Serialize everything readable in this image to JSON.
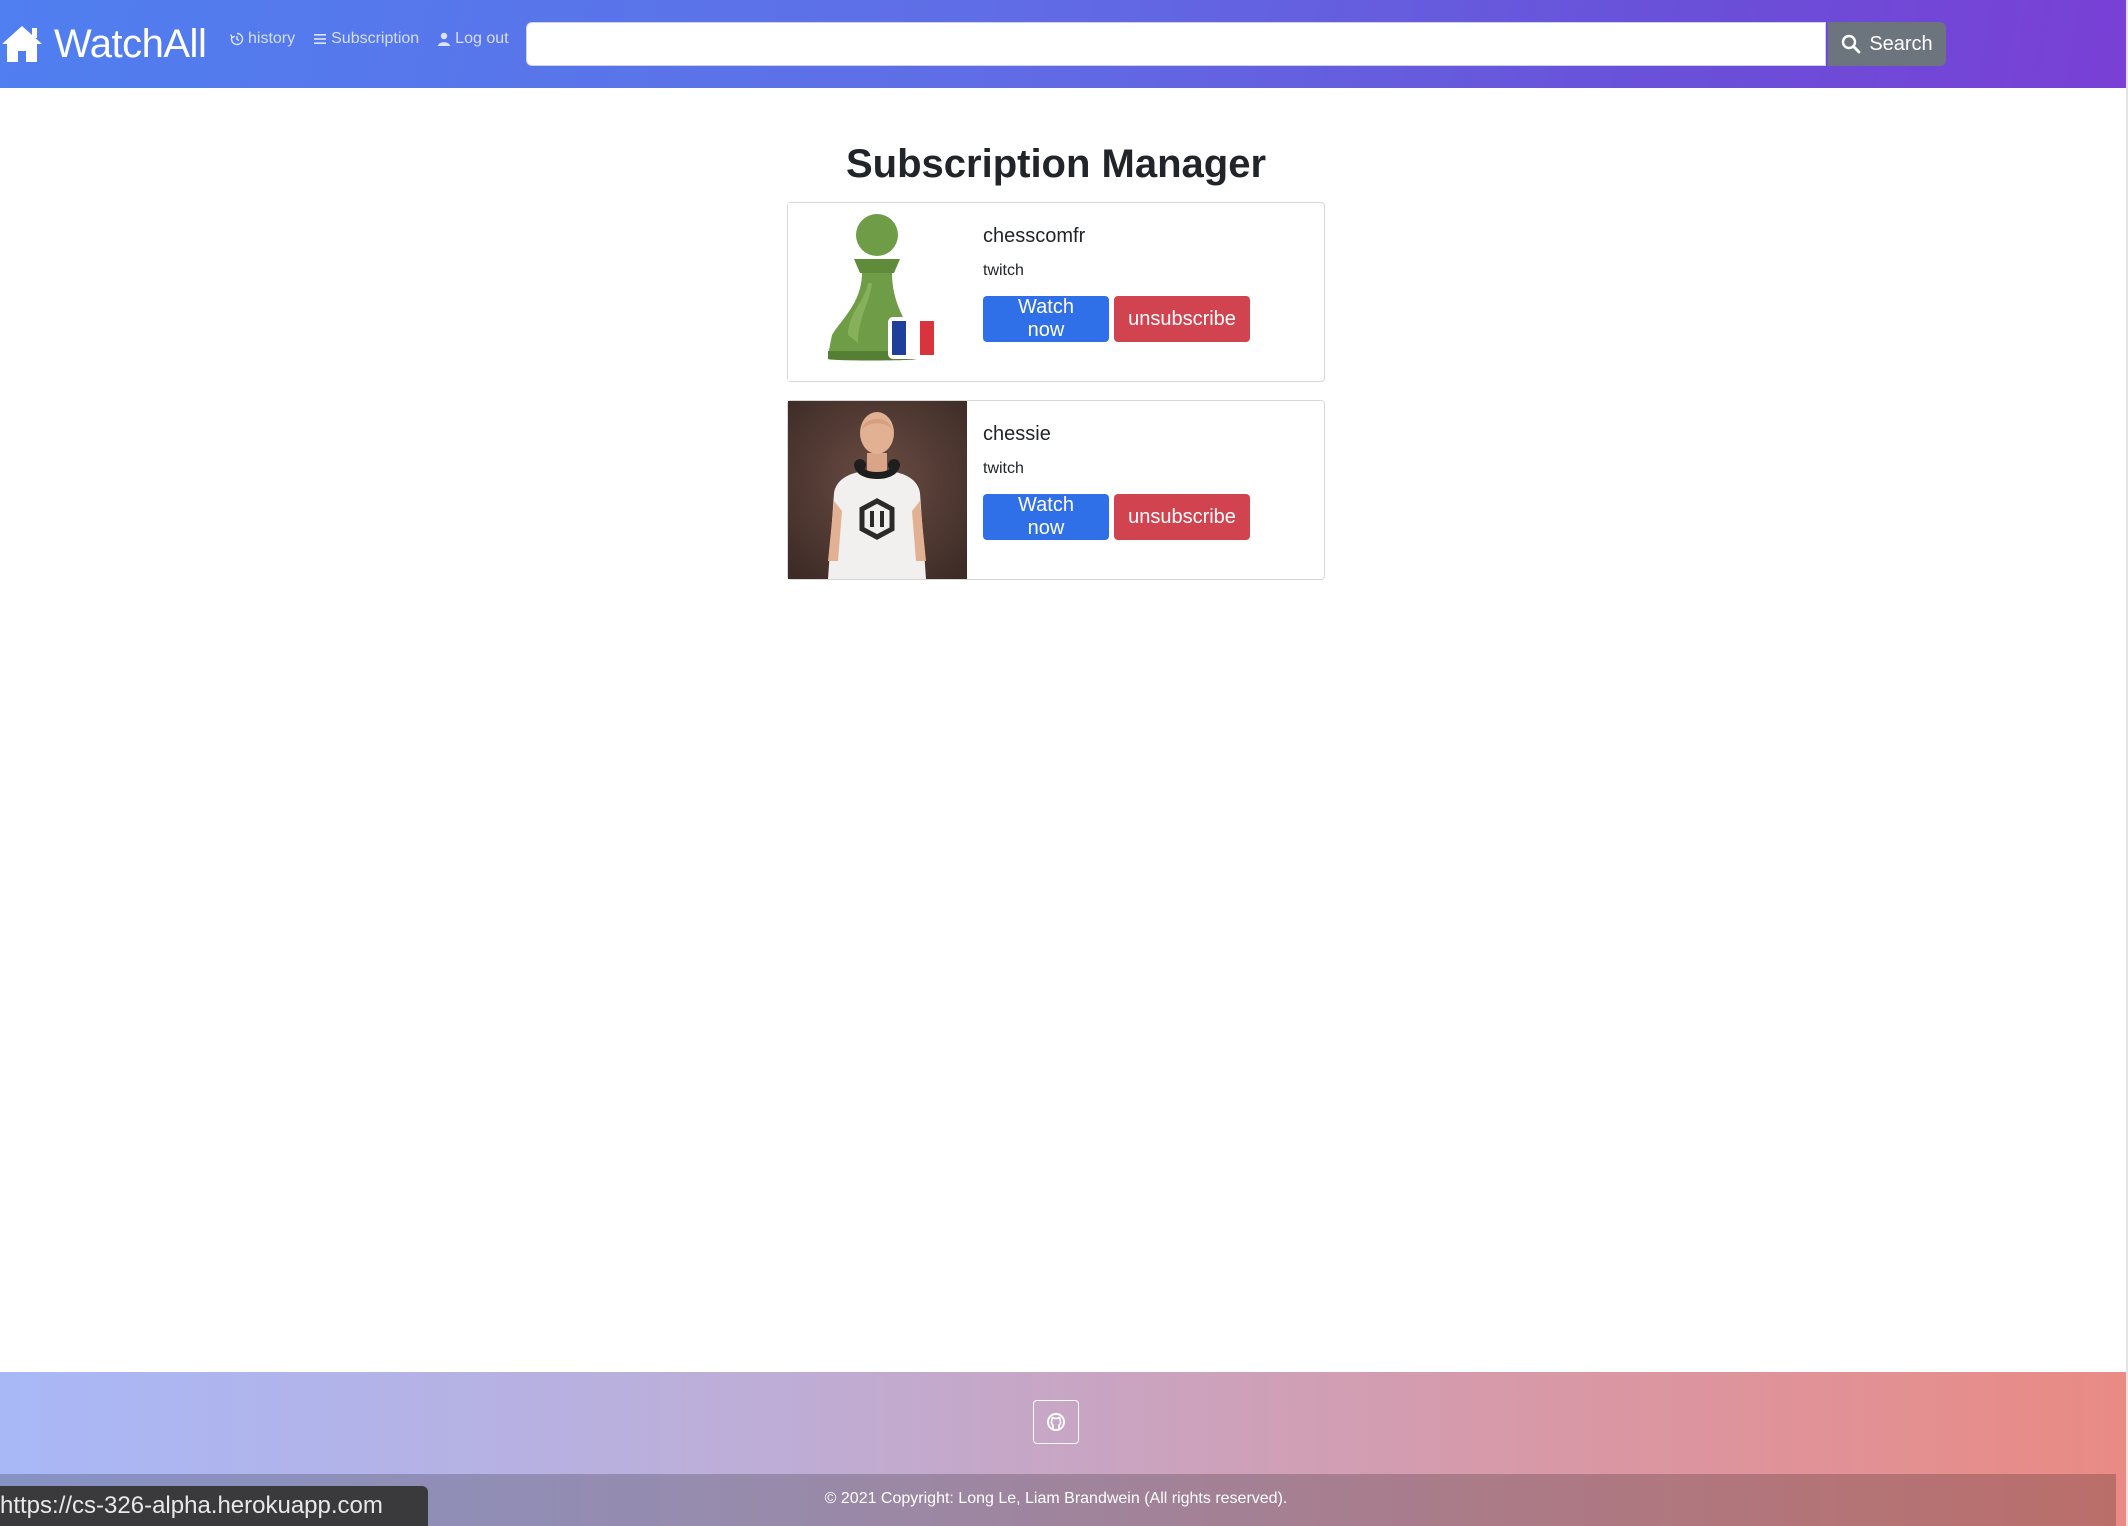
{
  "navbar": {
    "brand": "WatchAll",
    "brand_icon": "home-icon",
    "links": [
      {
        "label": "history",
        "icon": "history-icon"
      },
      {
        "label": "Subscription",
        "icon": "list-icon"
      },
      {
        "label": "Log out",
        "icon": "user-icon"
      }
    ],
    "search": {
      "value": "",
      "placeholder": "",
      "button_label": "Search",
      "button_icon": "search-icon"
    }
  },
  "main": {
    "title": "Subscription Manager",
    "subscriptions": [
      {
        "name": "chesscomfr",
        "platform": "twitch",
        "watch_label": "Watch now",
        "unsubscribe_label": "unsubscribe",
        "avatar": "chess-pawn-france-flag"
      },
      {
        "name": "chessie",
        "platform": "twitch",
        "watch_label": "Watch now",
        "unsubscribe_label": "unsubscribe",
        "avatar": "person-photo"
      }
    ]
  },
  "footer": {
    "github_icon": "github-icon",
    "copyright": "© 2021 Copyright: Long Le, Liam Brandwein (All rights reserved)."
  },
  "status_bar": {
    "url": "https://cs-326-alpha.herokuapp.com"
  },
  "colors": {
    "watch_button": "#2f6fe8",
    "unsubscribe_button": "#d0434f",
    "search_button": "#6c757d"
  }
}
